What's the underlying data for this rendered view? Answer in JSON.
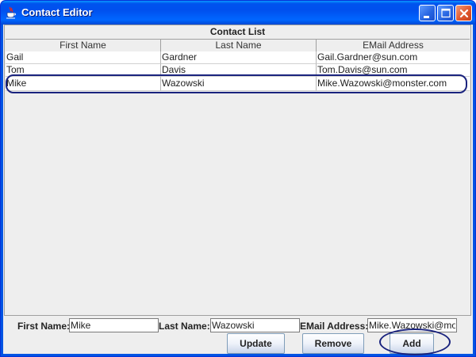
{
  "window": {
    "title": "Contact Editor",
    "icon": "java-cup-icon",
    "controls": [
      "minimize-icon",
      "maximize-icon",
      "close-icon"
    ]
  },
  "contact_list": {
    "title": "Contact List",
    "columns": [
      "First Name",
      "Last Name",
      "EMail Address"
    ],
    "rows": [
      [
        "Gail",
        "Gardner",
        "Gail.Gardner@sun.com"
      ],
      [
        "Tom",
        "Davis",
        "Tom.Davis@sun.com"
      ],
      [
        "Mike",
        "Wazowski",
        "Mike.Wazowski@monster.com"
      ]
    ]
  },
  "form": {
    "first_name_label": "First Name:",
    "first_name_value": "Mike",
    "last_name_label": "Last Name:",
    "last_name_value": "Wazowski",
    "email_label": "EMail Address:",
    "email_value": "Mike.Wazowski@monster.com"
  },
  "buttons": {
    "update": "Update",
    "remove": "Remove",
    "add": "Add"
  },
  "colors": {
    "titlebar": "#0054e3",
    "annotation": "#1a237e",
    "panel_bg": "#eeeeee"
  }
}
